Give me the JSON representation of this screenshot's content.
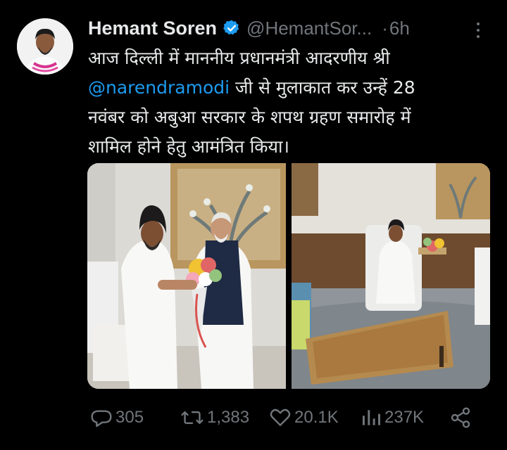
{
  "author": {
    "name": "Hemant Soren",
    "handle": "@HemantSor...",
    "separator": "·",
    "time": "6h"
  },
  "tweet": {
    "line1": "आज दिल्ली में माननीय प्रधानमंत्री आदरणीय श्री",
    "mention": "@narendramodi",
    "line2_rest": " जी से मुलाकात कर उन्हें 28",
    "line3": "नवंबर को अबुआ सरकार के शपथ ग्रहण समारोह में",
    "line4": "शामिल होने हेतु आमंत्रित किया।"
  },
  "media": [
    {
      "icon": "photo-meeting-handshake"
    },
    {
      "icon": "photo-meeting-seated"
    }
  ],
  "actions": {
    "replies": "305",
    "reposts": "1,383",
    "likes": "20.1K",
    "views": "237K"
  },
  "colors": {
    "background": "#000000",
    "text": "#e7e9ea",
    "secondary": "#71767b",
    "accent": "#1d9bf0"
  }
}
